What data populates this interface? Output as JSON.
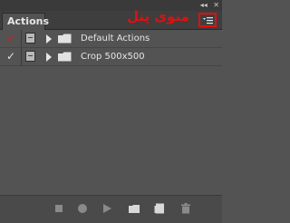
{
  "panel": {
    "tab_label": "Actions",
    "collapse_glyph": "◂◂",
    "close_glyph": "✕",
    "annotation": "منوی پنل",
    "menu_button_icon": "panel-menu-icon"
  },
  "actions": [
    {
      "label": "Default Actions",
      "checked": true,
      "check_color": "#d11a1a",
      "dialog_icon": "dialog-toggle-icon",
      "expand_icon": "expand-triangle-icon",
      "folder_icon": "folder-icon"
    },
    {
      "label": "Crop 500x500",
      "checked": true,
      "check_color": "#e0e0e0",
      "dialog_icon": "dialog-toggle-icon",
      "expand_icon": "expand-triangle-icon",
      "folder_icon": "folder-icon"
    }
  ],
  "toolbar": {
    "buttons": [
      "stop-icon",
      "record-icon",
      "play-icon",
      "new-set-folder-icon",
      "new-action-icon",
      "trash-icon"
    ]
  },
  "colors": {
    "panel_bg": "#535353",
    "text": "#e6e6e6",
    "annotation_red": "#e01010"
  }
}
